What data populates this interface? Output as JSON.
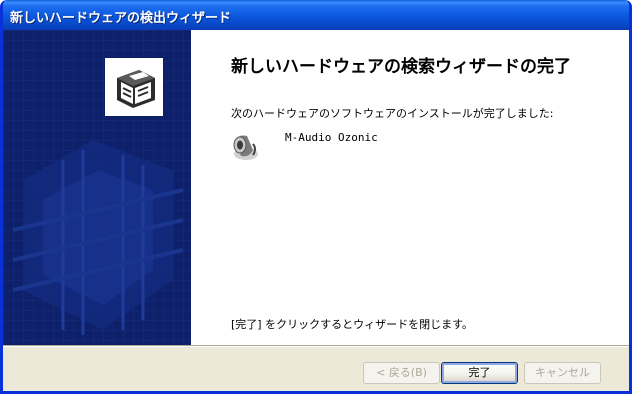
{
  "window": {
    "title": "新しいハードウェアの検出ウィザード"
  },
  "page": {
    "heading": "新しいハードウェアの検索ウィザードの完了",
    "message": "次のハードウェアのソフトウェアのインストールが完了しました:",
    "device_name": "M-Audio Ozonic",
    "device_icon": "speaker-icon",
    "footer_message": "[完了] をクリックするとウィザードを閉じます。"
  },
  "side_panel": {
    "icon": "hardware-install-icon",
    "background_color": "#0c1e63"
  },
  "buttons": {
    "back": "< 戻る(B)",
    "finish": "完了",
    "cancel": "キャンセル"
  },
  "colors": {
    "titlebar": "#0b57dc",
    "panel": "#0c1e63",
    "face": "#ece9d8"
  }
}
